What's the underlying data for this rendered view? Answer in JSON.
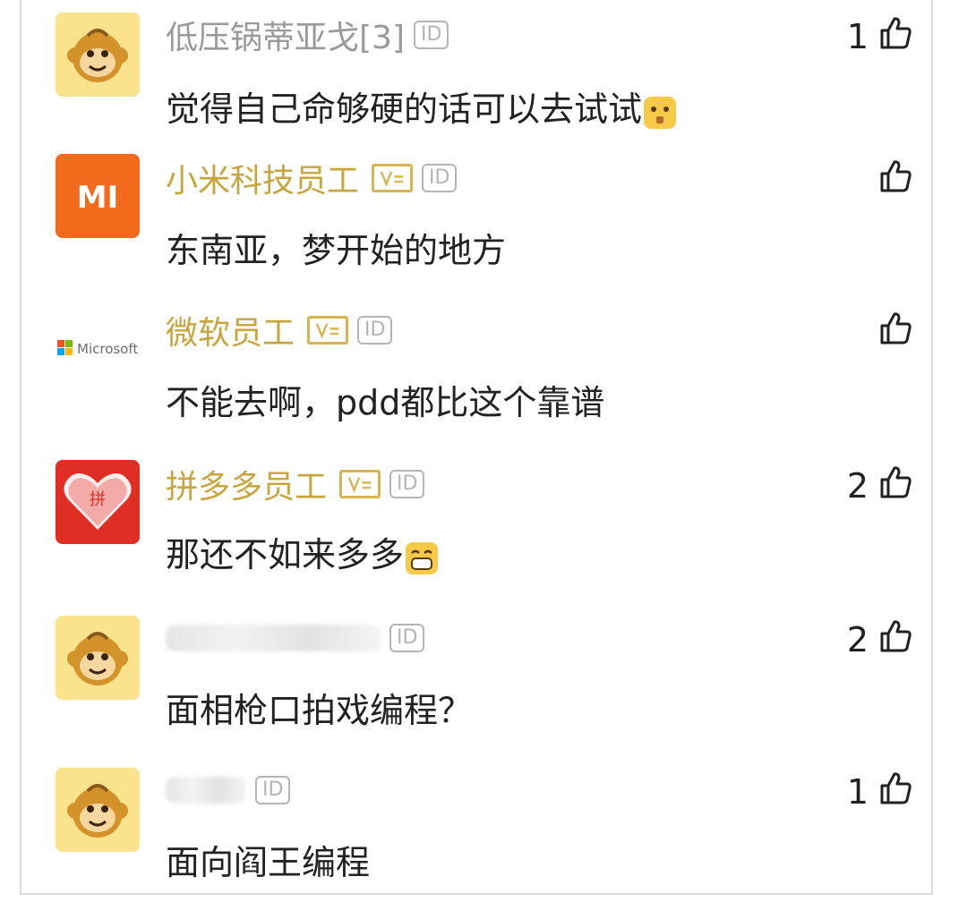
{
  "comments": [
    {
      "name": "低压锅蒂亚戈[3]",
      "badge_id": "ID",
      "text": "觉得自己命够硬的话可以去试试",
      "emoji": "shy-face-emoji",
      "likes": "1",
      "avatar": "monkey-avatar"
    },
    {
      "name": "小米科技员工",
      "badge_id": "ID",
      "text": "东南亚，梦开始的地方",
      "likes": "",
      "avatar": "xiaomi-logo",
      "avatar_text": "MI"
    },
    {
      "name": "微软员工",
      "badge_id": "ID",
      "text": "不能去啊，pdd都比这个靠谱",
      "likes": "",
      "avatar": "microsoft-logo",
      "avatar_text": "Microsoft"
    },
    {
      "name": "拼多多员工",
      "badge_id": "ID",
      "text": "那还不如来多多",
      "emoji": "grinning-face-emoji",
      "likes": "2",
      "avatar": "pinduoduo-logo",
      "avatar_text": "拼"
    },
    {
      "name": "",
      "badge_id": "ID",
      "text": "面相枪口拍戏编程？",
      "likes": "2",
      "avatar": "monkey-avatar"
    },
    {
      "name": "",
      "badge_id": "ID",
      "text": "面向阎王编程",
      "likes": "1",
      "avatar": "monkey-avatar"
    }
  ],
  "colors": {
    "company_name": "#c9a53e",
    "user_name": "#9a9a9a",
    "xiaomi": "#f26a1b",
    "pinduoduo": "#e02e24"
  }
}
